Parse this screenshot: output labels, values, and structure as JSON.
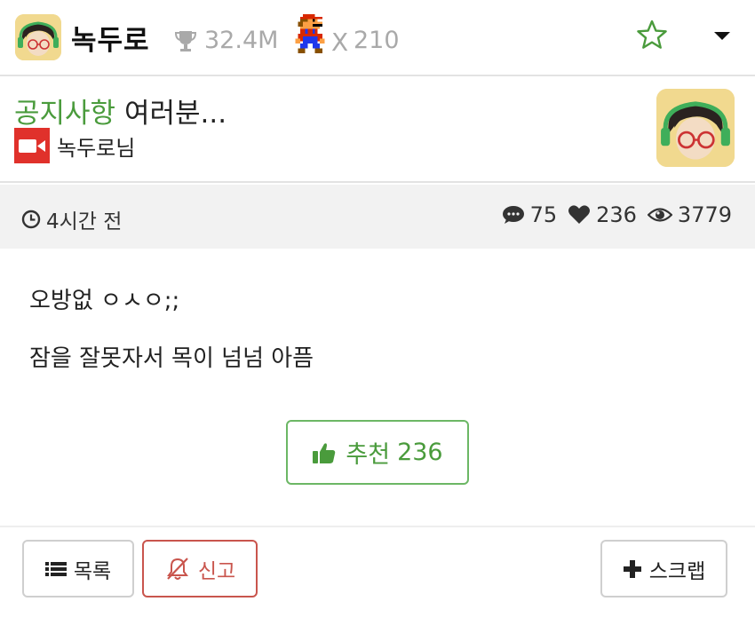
{
  "header": {
    "username": "녹두로",
    "points": "32.4M",
    "multiplier_sign": "X",
    "level": "210",
    "colors": {
      "accent": "#4a9b3c",
      "muted": "#a9a9a9"
    }
  },
  "post": {
    "category": "공지사항",
    "title": "여러분...",
    "author": "녹두로님"
  },
  "meta": {
    "time_ago": "4시간 전",
    "comments": "75",
    "likes": "236",
    "views": "3779"
  },
  "body": {
    "line1": "오방없 ㅇㅅㅇ;;",
    "line2": "잠을 잘못자서 목이 넘넘 아픔"
  },
  "actions": {
    "recommend_label": "추천",
    "recommend_count": "236",
    "list_label": "목록",
    "report_label": "신고",
    "scrap_label": "스크랩",
    "report_color": "#c9554d"
  },
  "icons": [
    "avatar",
    "trophy-icon",
    "mario-icon",
    "star-icon",
    "caret-down-icon",
    "video-icon",
    "clock-icon",
    "comment-icon",
    "heart-icon",
    "eye-icon",
    "thumbs-up-icon",
    "list-icon",
    "bell-off-icon",
    "plus-icon"
  ]
}
